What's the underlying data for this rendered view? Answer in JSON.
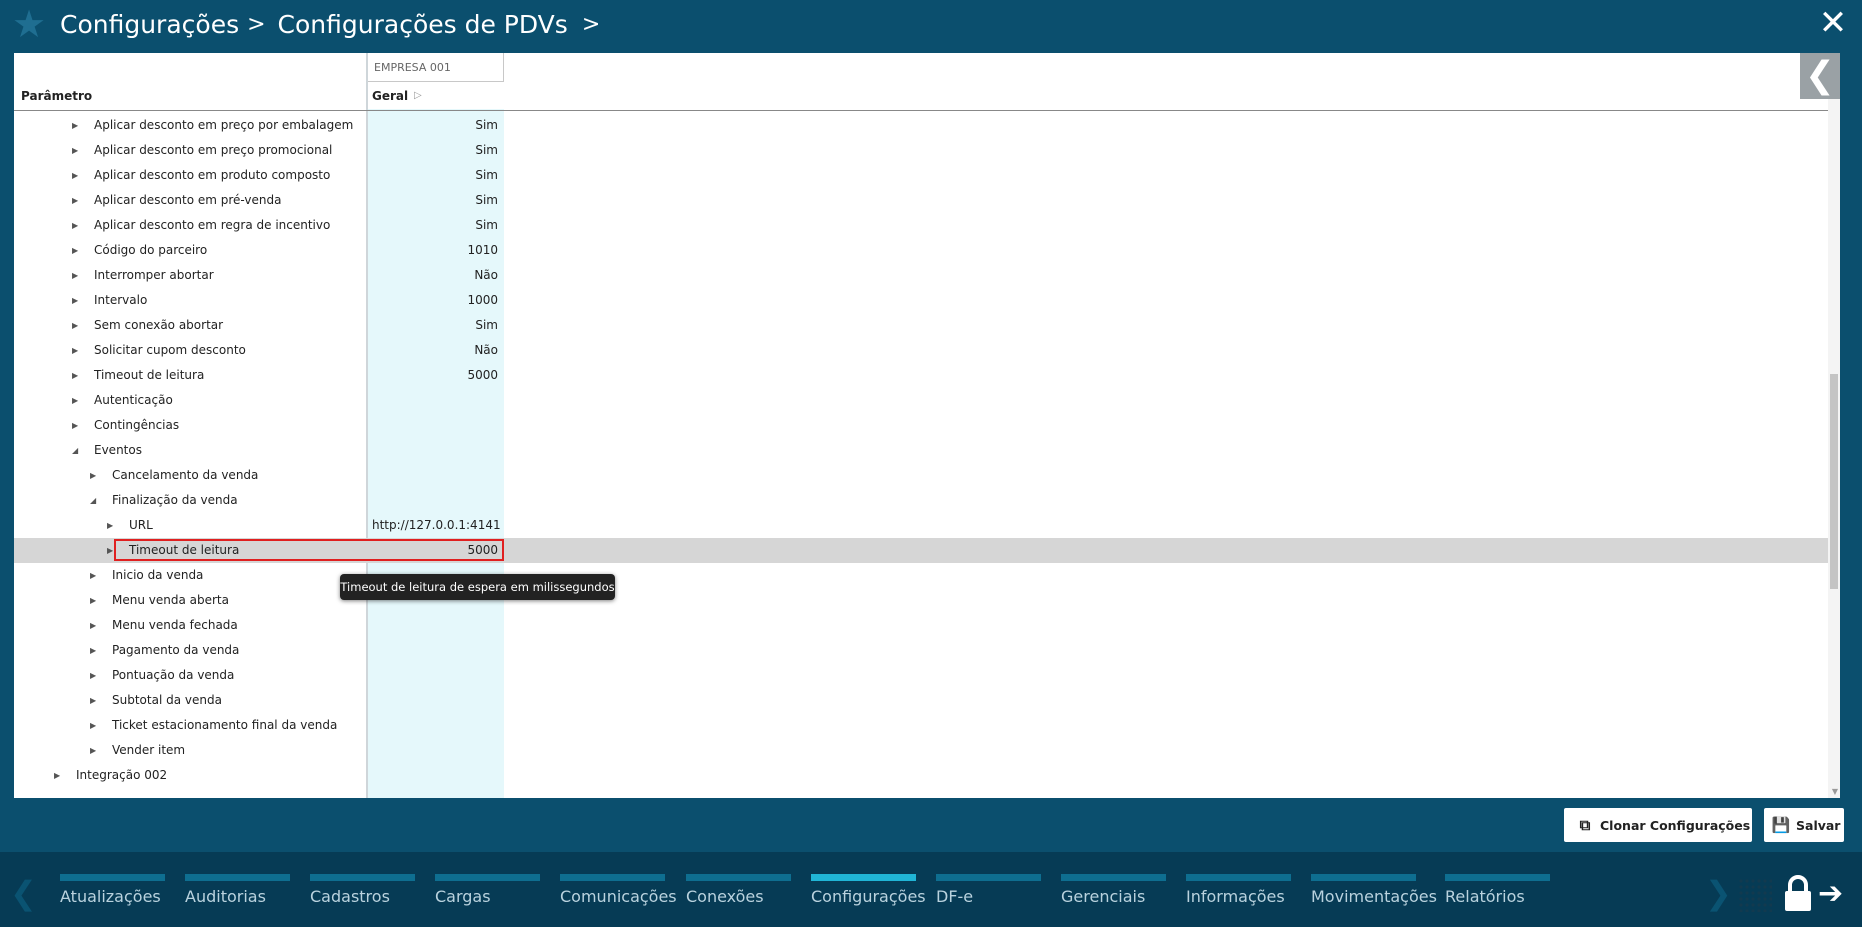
{
  "header": {
    "breadcrumb": [
      "Configurações",
      "Configurações de PDVs"
    ],
    "sep": ">"
  },
  "table": {
    "company_header": "EMPRESA 001",
    "param_header": "Parâmetro",
    "general_header": "Geral",
    "rows": [
      {
        "label": "Aplicar desconto em preço por embalagem",
        "value": "Sim",
        "level": 3,
        "expanded": false
      },
      {
        "label": "Aplicar desconto em preço promocional",
        "value": "Sim",
        "level": 3,
        "expanded": false
      },
      {
        "label": "Aplicar desconto em produto composto",
        "value": "Sim",
        "level": 3,
        "expanded": false
      },
      {
        "label": "Aplicar desconto em pré-venda",
        "value": "Sim",
        "level": 3,
        "expanded": false
      },
      {
        "label": "Aplicar desconto em regra de incentivo",
        "value": "Sim",
        "level": 3,
        "expanded": false
      },
      {
        "label": "Código do parceiro",
        "value": "1010",
        "level": 3,
        "expanded": false
      },
      {
        "label": "Interromper abortar",
        "value": "Não",
        "level": 3,
        "expanded": false
      },
      {
        "label": "Intervalo",
        "value": "1000",
        "level": 3,
        "expanded": false
      },
      {
        "label": "Sem conexão abortar",
        "value": "Sim",
        "level": 3,
        "expanded": false
      },
      {
        "label": "Solicitar cupom desconto",
        "value": "Não",
        "level": 3,
        "expanded": false
      },
      {
        "label": "Timeout de leitura",
        "value": "5000",
        "level": 3,
        "expanded": false
      },
      {
        "label": "Autenticação",
        "value": "",
        "level": 3,
        "expanded": false
      },
      {
        "label": "Contingências",
        "value": "",
        "level": 3,
        "expanded": false
      },
      {
        "label": "Eventos",
        "value": "",
        "level": 3,
        "expanded": true
      },
      {
        "label": "Cancelamento da venda",
        "value": "",
        "level": 4,
        "expanded": false
      },
      {
        "label": "Finalização da venda",
        "value": "",
        "level": 4,
        "expanded": true
      },
      {
        "label": "URL",
        "value": "http://127.0.0.1:4141",
        "level": 5,
        "expanded": false
      },
      {
        "label": "Timeout de leitura",
        "value": "5000",
        "level": 5,
        "expanded": false,
        "selected": true
      },
      {
        "label": "Inicio da venda",
        "value": "",
        "level": 4,
        "expanded": false
      },
      {
        "label": "Menu venda aberta",
        "value": "",
        "level": 4,
        "expanded": false
      },
      {
        "label": "Menu venda fechada",
        "value": "",
        "level": 4,
        "expanded": false
      },
      {
        "label": "Pagamento da venda",
        "value": "",
        "level": 4,
        "expanded": false
      },
      {
        "label": "Pontuação da venda",
        "value": "",
        "level": 4,
        "expanded": false
      },
      {
        "label": "Subtotal da venda",
        "value": "",
        "level": 4,
        "expanded": false
      },
      {
        "label": "Ticket estacionamento final da venda",
        "value": "",
        "level": 4,
        "expanded": false
      },
      {
        "label": "Vender item",
        "value": "",
        "level": 4,
        "expanded": false
      },
      {
        "label": "Integração 002",
        "value": "",
        "level": 2,
        "expanded": false
      }
    ]
  },
  "tooltip": "Timeout de leitura de espera em milissegundos",
  "buttons": {
    "clone": "Clonar Configurações",
    "save": "Salvar"
  },
  "nav": {
    "items": [
      "Atualizações",
      "Auditorias",
      "Cadastros",
      "Cargas",
      "Comunicações",
      "Conexões",
      "Configurações",
      "DF-e",
      "Gerenciais",
      "Informações",
      "Movimentações",
      "Relatórios"
    ],
    "active": "Configurações"
  },
  "colors": {
    "background": "#0b4f6e",
    "nav": "#063b55",
    "nav_active": "#20b5d6",
    "column_highlight": "#e5f8fb",
    "selection_border": "#e02020"
  }
}
